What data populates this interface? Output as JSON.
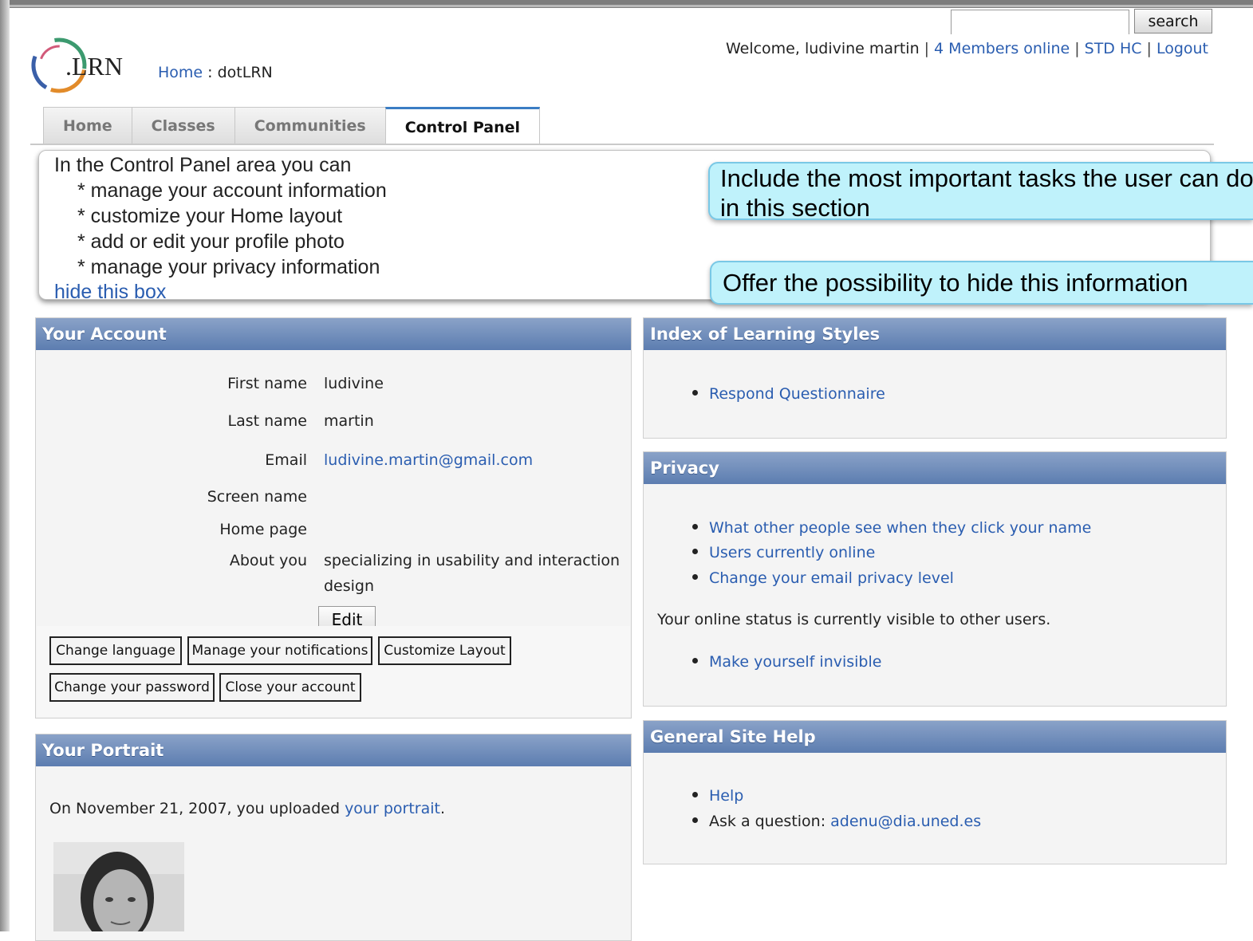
{
  "header": {
    "search_button": "search",
    "welcome_text": "Welcome, ludivine martin",
    "members_online": "4 Members online",
    "std_hc": "STD HC",
    "logout": "Logout",
    "breadcrumb_home": "Home",
    "breadcrumb_sep": ":",
    "breadcrumb_current": "dotLRN",
    "logo_text": ".LRN"
  },
  "tabs": [
    "Home",
    "Classes",
    "Communities",
    "Control Panel"
  ],
  "info_box": {
    "intro": "In the Control Panel area you can",
    "bullets": [
      "* manage your account information",
      "* customize your Home layout",
      "* add or edit your profile photo",
      "* manage your privacy information"
    ],
    "hide_link": "hide this box"
  },
  "callouts": {
    "tasks": "Include the most important tasks the user can do in this section",
    "hide": "Offer the possibility to hide this information"
  },
  "account": {
    "title": "Your Account",
    "labels": {
      "first_name": "First name",
      "last_name": "Last name",
      "email": "Email",
      "screen_name": "Screen name",
      "home_page": "Home page",
      "about_you": "About you"
    },
    "values": {
      "first_name": "ludivine",
      "last_name": "martin",
      "email": "ludivine.martin@gmail.com",
      "about_you_line1": "specializing in usability and interaction",
      "about_you_line2": "design"
    },
    "edit_button": "Edit",
    "buttons": {
      "change_language": "Change language",
      "manage_notifications": "Manage your notifications",
      "customize_layout": "Customize Layout",
      "change_password": "Change your password",
      "close_account": "Close your account"
    }
  },
  "portrait": {
    "title": "Your Portrait",
    "text_before": "On November 21, 2007, you uploaded",
    "link": "your portrait",
    "text_after": "."
  },
  "learning_styles": {
    "title": "Index of Learning Styles",
    "items": [
      "Respond Questionnaire"
    ]
  },
  "privacy": {
    "title": "Privacy",
    "items": [
      "What other people see when they click your name",
      "Users currently online",
      "Change your email privacy level"
    ],
    "status": "Your online status is currently visible to other users.",
    "invisible_link": "Make yourself invisible"
  },
  "help": {
    "title": "General Site Help",
    "help_link": "Help",
    "ask_label": "Ask a question:",
    "ask_email": "adenu@dia.uned.es"
  },
  "colors": {
    "link": "#2a5db0",
    "panel_header": "#6b89b8",
    "callout_bg": "#bff2fb",
    "active_tab_accent": "#3b7dc4"
  }
}
